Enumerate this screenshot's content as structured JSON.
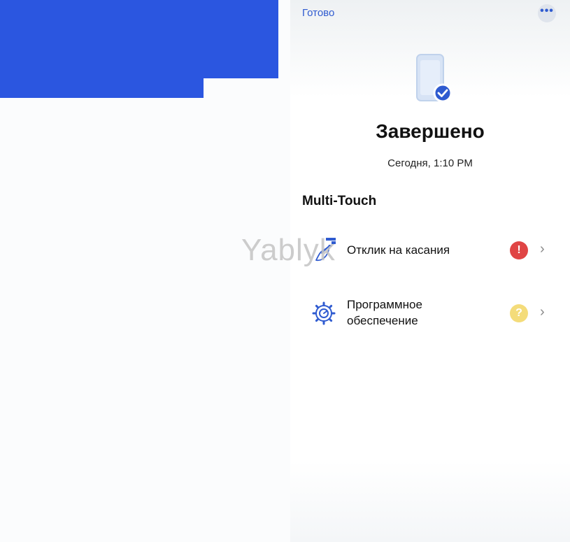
{
  "header": {
    "done_label": "Готово",
    "more_icon": "ellipsis-icon"
  },
  "status": {
    "icon": "iphone-check-icon",
    "title": "Завершено",
    "timestamp": "Сегодня, 1:10 PM"
  },
  "section": {
    "title": "Multi-Touch"
  },
  "items": [
    {
      "label": "Отклик на касания",
      "icon": "touch-hand-icon",
      "status": "error",
      "status_symbol": "!",
      "status_color": "#e04545"
    },
    {
      "label_line1": "Программное",
      "label_line2": "обеспечение",
      "icon": "gear-icon",
      "status": "unknown",
      "status_symbol": "?",
      "status_color": "#f4dc7a"
    }
  ],
  "watermark": "Yablyk",
  "colors": {
    "accent": "#2f5bd0",
    "left_block": "#2b56e0"
  }
}
